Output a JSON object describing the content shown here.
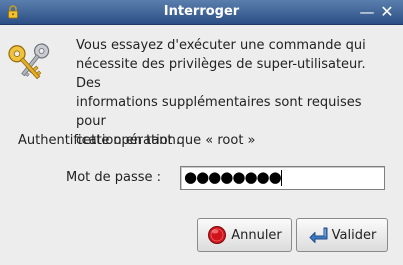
{
  "window": {
    "title": "Interroger",
    "minimize_glyph": "—",
    "close_glyph": "✕"
  },
  "dialog": {
    "message_lines": [
      "Vous essayez d'exécuter une commande qui",
      "nécessite des privilèges de super-utilisateur. Des",
      "informations supplémentaires sont requises pour",
      "cette opération."
    ],
    "auth_label": "Authentification en tant que « root »",
    "password_label": "Mot de passe :",
    "password_value": "●●●●●●●●"
  },
  "buttons": {
    "cancel_label": "Annuler",
    "ok_label": "Valider"
  },
  "icons": {
    "title": "padlock-icon",
    "dialog": "keys-icon",
    "cancel": "stop-icon",
    "ok": "enter-arrow-icon"
  },
  "colors": {
    "titlebar": "#3a6097",
    "window_bg": "#ededed",
    "stop_red": "#d0141b",
    "enter_blue": "#3f79c4"
  }
}
